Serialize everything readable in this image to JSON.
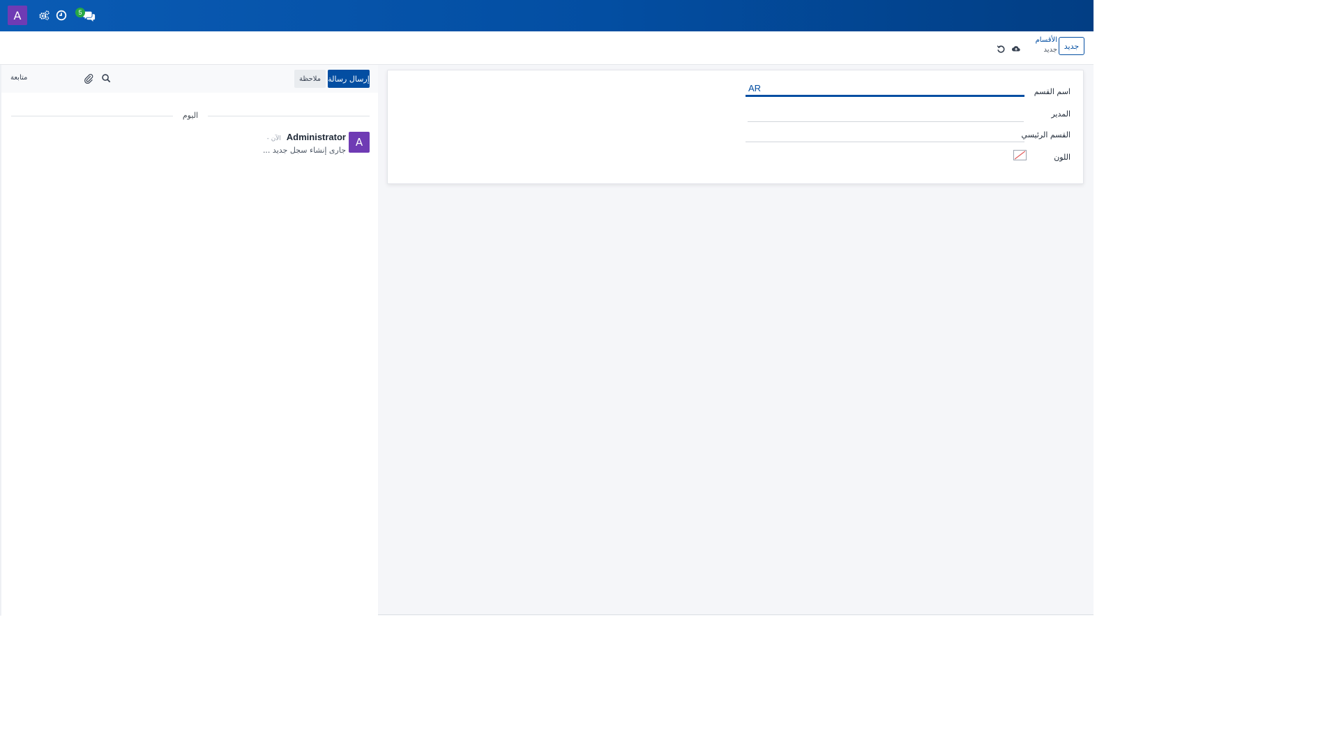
{
  "navbar": {
    "user_initial": "A",
    "icons": [
      "cogs-icon",
      "clock-icon",
      "comments-icon"
    ],
    "messages_badge": "5",
    "colors": {
      "background": "#034ea2",
      "avatar": "#6f3bb4",
      "badge": "#28a745"
    }
  },
  "control_panel": {
    "new_button": "جديد",
    "breadcrumb": {
      "parent": "الأقسام",
      "current": "جديد"
    },
    "icons": [
      "cloud-upload-icon",
      "undo-icon"
    ]
  },
  "form": {
    "fields": {
      "name": {
        "label": "اسم القسم",
        "value": "AR"
      },
      "manager": {
        "label": "المدير",
        "value": ""
      },
      "parent": {
        "label": "القسم الرئيسي",
        "value": ""
      },
      "color": {
        "label": "اللون"
      }
    }
  },
  "chatter": {
    "send_message": "إرسال رسالة",
    "log_note": "ملاحظة",
    "follow": "متابعة",
    "icons": [
      "search-icon",
      "paperclip-icon"
    ],
    "date_separator": "اليوم",
    "messages": [
      {
        "author_initial": "A",
        "author": "Administrator",
        "time": "- الآن",
        "body": "جارى إنشاء سجل جديد ..."
      }
    ]
  }
}
